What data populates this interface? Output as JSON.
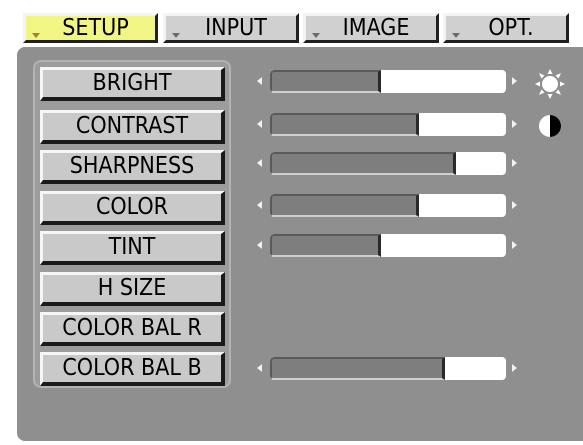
{
  "tabs": [
    {
      "label": "SETUP",
      "active": true
    },
    {
      "label": "INPUT",
      "active": false
    },
    {
      "label": "IMAGE",
      "active": false
    },
    {
      "label": "OPT.",
      "active": false
    }
  ],
  "settings": [
    {
      "label": "BRIGHT",
      "level": 0.47,
      "icon": "brightness-sun-icon"
    },
    {
      "label": "CONTRAST",
      "level": 0.63,
      "icon": "contrast-half-circle-icon"
    },
    {
      "label": "SHARPNESS",
      "level": 0.79,
      "icon": null
    },
    {
      "label": "COLOR",
      "level": 0.63,
      "icon": null
    },
    {
      "label": "TINT",
      "level": 0.47,
      "icon": null
    },
    {
      "label": "H SIZE",
      "level": null,
      "icon": null
    },
    {
      "label": "COLOR BAL R",
      "level": null,
      "icon": null
    },
    {
      "label": "COLOR BAL B",
      "level": 0.74,
      "icon": null
    }
  ],
  "colors": {
    "active_tab": "#f1f584",
    "panel": "#8f8f8f",
    "button": "#c9c9c9",
    "slider_fill": "#7e7e7e",
    "slider_track": "#ffffff"
  }
}
